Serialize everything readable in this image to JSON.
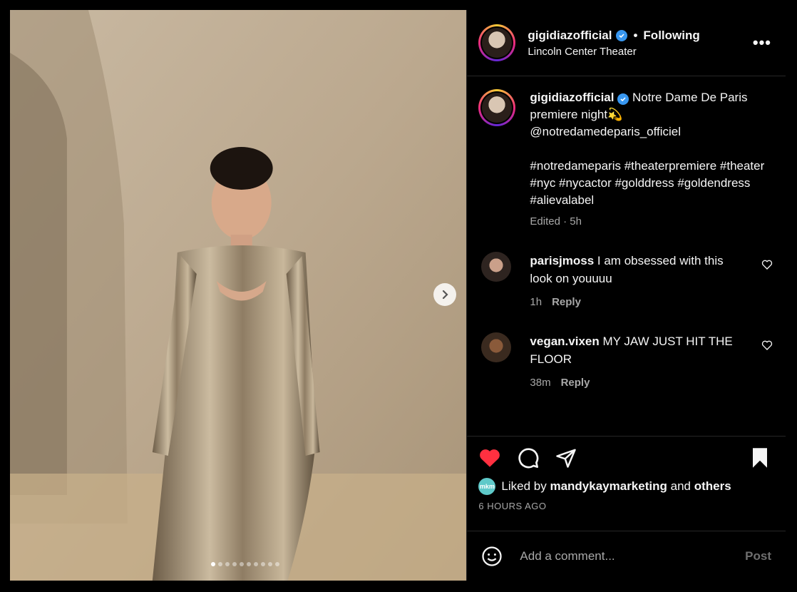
{
  "post": {
    "username": "gigidiazofficial",
    "follow_status": "Following",
    "separator": "•",
    "location": "Lincoln Center Theater",
    "more_label": "•••"
  },
  "caption": {
    "username": "gigidiazofficial",
    "text": "Notre Dame De Paris premiere night💫",
    "mention": "@notredamedeparis_officiel",
    "hashtags": "#notredameparis #theaterpremiere #theater #nyc #nycactor #golddress #goldendress #alievalabel",
    "meta": "Edited · 5h"
  },
  "comments": [
    {
      "username": "parisjmoss",
      "text": "I am obsessed with this look on youuuu",
      "time": "1h",
      "reply": "Reply"
    },
    {
      "username": "vegan.vixen",
      "text": "MY JAW JUST HIT THE FLOOR",
      "time": "38m",
      "reply": "Reply"
    }
  ],
  "likes": {
    "prefix": "Liked by",
    "user": "mandykaymarketing",
    "and": "and",
    "others": "others",
    "mini_avatar": "mkm"
  },
  "timestamp": "6 HOURS AGO",
  "add_comment": {
    "placeholder": "Add a comment...",
    "post_label": "Post"
  },
  "carousel": {
    "total": 10,
    "current": 1
  },
  "colors": {
    "like_red": "#ff3040",
    "verified_blue": "#3897f0",
    "background": "#000000"
  }
}
